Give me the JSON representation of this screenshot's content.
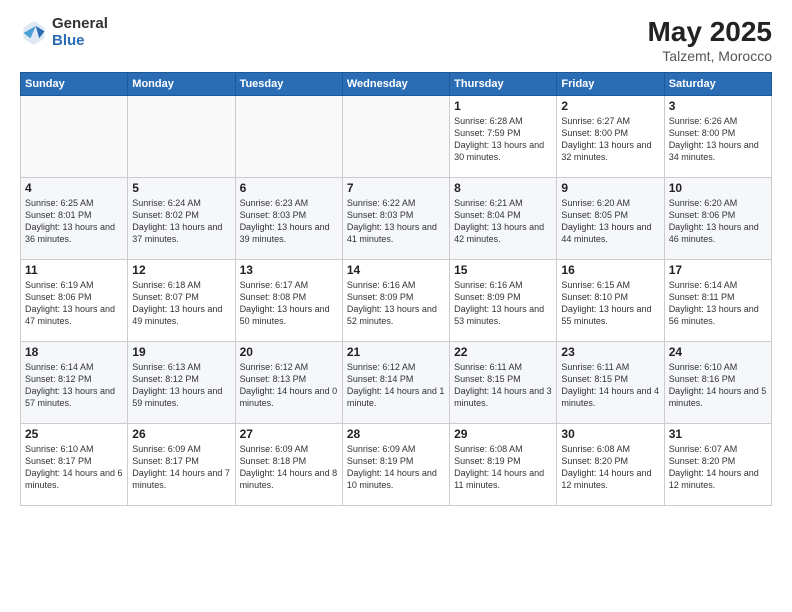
{
  "logo": {
    "general": "General",
    "blue": "Blue"
  },
  "title": {
    "month_year": "May 2025",
    "location": "Talzemt, Morocco"
  },
  "weekdays": [
    "Sunday",
    "Monday",
    "Tuesday",
    "Wednesday",
    "Thursday",
    "Friday",
    "Saturday"
  ],
  "weeks": [
    [
      {
        "day": "",
        "text": ""
      },
      {
        "day": "",
        "text": ""
      },
      {
        "day": "",
        "text": ""
      },
      {
        "day": "",
        "text": ""
      },
      {
        "day": "1",
        "text": "Sunrise: 6:28 AM\nSunset: 7:59 PM\nDaylight: 13 hours and 30 minutes."
      },
      {
        "day": "2",
        "text": "Sunrise: 6:27 AM\nSunset: 8:00 PM\nDaylight: 13 hours and 32 minutes."
      },
      {
        "day": "3",
        "text": "Sunrise: 6:26 AM\nSunset: 8:00 PM\nDaylight: 13 hours and 34 minutes."
      }
    ],
    [
      {
        "day": "4",
        "text": "Sunrise: 6:25 AM\nSunset: 8:01 PM\nDaylight: 13 hours and 36 minutes."
      },
      {
        "day": "5",
        "text": "Sunrise: 6:24 AM\nSunset: 8:02 PM\nDaylight: 13 hours and 37 minutes."
      },
      {
        "day": "6",
        "text": "Sunrise: 6:23 AM\nSunset: 8:03 PM\nDaylight: 13 hours and 39 minutes."
      },
      {
        "day": "7",
        "text": "Sunrise: 6:22 AM\nSunset: 8:03 PM\nDaylight: 13 hours and 41 minutes."
      },
      {
        "day": "8",
        "text": "Sunrise: 6:21 AM\nSunset: 8:04 PM\nDaylight: 13 hours and 42 minutes."
      },
      {
        "day": "9",
        "text": "Sunrise: 6:20 AM\nSunset: 8:05 PM\nDaylight: 13 hours and 44 minutes."
      },
      {
        "day": "10",
        "text": "Sunrise: 6:20 AM\nSunset: 8:06 PM\nDaylight: 13 hours and 46 minutes."
      }
    ],
    [
      {
        "day": "11",
        "text": "Sunrise: 6:19 AM\nSunset: 8:06 PM\nDaylight: 13 hours and 47 minutes."
      },
      {
        "day": "12",
        "text": "Sunrise: 6:18 AM\nSunset: 8:07 PM\nDaylight: 13 hours and 49 minutes."
      },
      {
        "day": "13",
        "text": "Sunrise: 6:17 AM\nSunset: 8:08 PM\nDaylight: 13 hours and 50 minutes."
      },
      {
        "day": "14",
        "text": "Sunrise: 6:16 AM\nSunset: 8:09 PM\nDaylight: 13 hours and 52 minutes."
      },
      {
        "day": "15",
        "text": "Sunrise: 6:16 AM\nSunset: 8:09 PM\nDaylight: 13 hours and 53 minutes."
      },
      {
        "day": "16",
        "text": "Sunrise: 6:15 AM\nSunset: 8:10 PM\nDaylight: 13 hours and 55 minutes."
      },
      {
        "day": "17",
        "text": "Sunrise: 6:14 AM\nSunset: 8:11 PM\nDaylight: 13 hours and 56 minutes."
      }
    ],
    [
      {
        "day": "18",
        "text": "Sunrise: 6:14 AM\nSunset: 8:12 PM\nDaylight: 13 hours and 57 minutes."
      },
      {
        "day": "19",
        "text": "Sunrise: 6:13 AM\nSunset: 8:12 PM\nDaylight: 13 hours and 59 minutes."
      },
      {
        "day": "20",
        "text": "Sunrise: 6:12 AM\nSunset: 8:13 PM\nDaylight: 14 hours and 0 minutes."
      },
      {
        "day": "21",
        "text": "Sunrise: 6:12 AM\nSunset: 8:14 PM\nDaylight: 14 hours and 1 minute."
      },
      {
        "day": "22",
        "text": "Sunrise: 6:11 AM\nSunset: 8:15 PM\nDaylight: 14 hours and 3 minutes."
      },
      {
        "day": "23",
        "text": "Sunrise: 6:11 AM\nSunset: 8:15 PM\nDaylight: 14 hours and 4 minutes."
      },
      {
        "day": "24",
        "text": "Sunrise: 6:10 AM\nSunset: 8:16 PM\nDaylight: 14 hours and 5 minutes."
      }
    ],
    [
      {
        "day": "25",
        "text": "Sunrise: 6:10 AM\nSunset: 8:17 PM\nDaylight: 14 hours and 6 minutes."
      },
      {
        "day": "26",
        "text": "Sunrise: 6:09 AM\nSunset: 8:17 PM\nDaylight: 14 hours and 7 minutes."
      },
      {
        "day": "27",
        "text": "Sunrise: 6:09 AM\nSunset: 8:18 PM\nDaylight: 14 hours and 8 minutes."
      },
      {
        "day": "28",
        "text": "Sunrise: 6:09 AM\nSunset: 8:19 PM\nDaylight: 14 hours and 10 minutes."
      },
      {
        "day": "29",
        "text": "Sunrise: 6:08 AM\nSunset: 8:19 PM\nDaylight: 14 hours and 11 minutes."
      },
      {
        "day": "30",
        "text": "Sunrise: 6:08 AM\nSunset: 8:20 PM\nDaylight: 14 hours and 12 minutes."
      },
      {
        "day": "31",
        "text": "Sunrise: 6:07 AM\nSunset: 8:20 PM\nDaylight: 14 hours and 12 minutes."
      }
    ]
  ]
}
